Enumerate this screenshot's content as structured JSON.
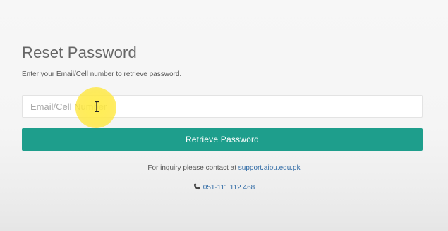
{
  "page": {
    "title": "Reset Password",
    "subtitle": "Enter your Email/Cell number to retrieve password."
  },
  "form": {
    "input_placeholder": "Email/Cell Number",
    "input_value": "",
    "submit_label": "Retrieve Password"
  },
  "footer": {
    "inquiry_text": "For inquiry please contact at",
    "support_link": "support.aiou.edu.pk",
    "phone": "051-111 112 468"
  },
  "icons": {
    "phone": "phone-icon"
  },
  "colors": {
    "accent": "#1e9e8c",
    "link": "#2f6aa5"
  }
}
